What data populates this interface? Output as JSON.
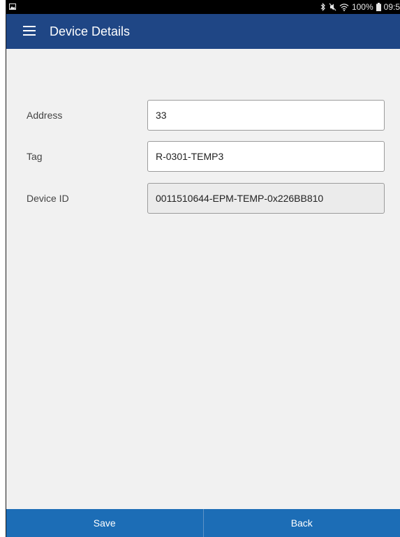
{
  "status_bar": {
    "battery_text": "100%",
    "time_text": "09:5",
    "icons": [
      "image-icon",
      "bluetooth-icon",
      "mute-icon",
      "wifi-icon",
      "battery-icon"
    ]
  },
  "app_bar": {
    "title": "Device Details",
    "menu_icon": "hamburger-menu-icon",
    "background_color": "#1f4685"
  },
  "form": {
    "address": {
      "label": "Address",
      "value": "33"
    },
    "tag": {
      "label": "Tag",
      "value": "R-0301-TEMP3"
    },
    "device_id": {
      "label": "Device ID",
      "value": "0011510644-EPM-TEMP-0x226BB810"
    }
  },
  "bottom_bar": {
    "save_label": "Save",
    "back_label": "Back",
    "background_color": "#1c6db6"
  }
}
